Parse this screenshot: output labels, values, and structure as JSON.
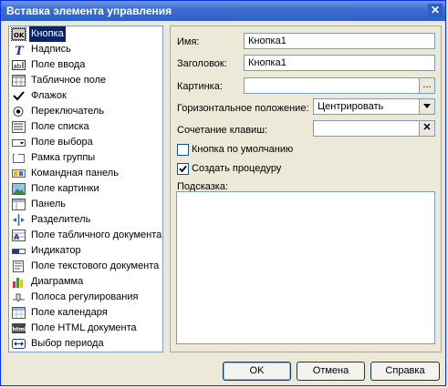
{
  "window": {
    "title": "Вставка элемента управления",
    "close_glyph": "✕"
  },
  "controls_list": [
    {
      "label": "Кнопка",
      "icon": "button-icon",
      "selected": true
    },
    {
      "label": "Надпись",
      "icon": "label-icon"
    },
    {
      "label": "Поле ввода",
      "icon": "input-field-icon"
    },
    {
      "label": "Табличное поле",
      "icon": "table-field-icon"
    },
    {
      "label": "Флажок",
      "icon": "checkbox-icon"
    },
    {
      "label": "Переключатель",
      "icon": "radio-icon"
    },
    {
      "label": "Поле списка",
      "icon": "list-field-icon"
    },
    {
      "label": "Поле выбора",
      "icon": "combo-field-icon"
    },
    {
      "label": "Рамка группы",
      "icon": "group-frame-icon"
    },
    {
      "label": "Командная панель",
      "icon": "command-panel-icon"
    },
    {
      "label": "Поле картинки",
      "icon": "picture-field-icon"
    },
    {
      "label": "Панель",
      "icon": "panel-icon"
    },
    {
      "label": "Разделитель",
      "icon": "splitter-icon"
    },
    {
      "label": "Поле табличного документа",
      "icon": "spreadsheet-field-icon"
    },
    {
      "label": "Индикатор",
      "icon": "indicator-icon"
    },
    {
      "label": "Поле текстового документа",
      "icon": "text-document-field-icon"
    },
    {
      "label": "Диаграмма",
      "icon": "chart-icon"
    },
    {
      "label": "Полоса регулирования",
      "icon": "slider-icon"
    },
    {
      "label": "Поле календаря",
      "icon": "calendar-field-icon"
    },
    {
      "label": "Поле HTML документа",
      "icon": "html-field-icon"
    },
    {
      "label": "Выбор периода",
      "icon": "period-select-icon"
    }
  ],
  "properties": {
    "name_label": "Имя:",
    "name_value": "Кнопка1",
    "caption_label": "Заголовок:",
    "caption_value": "Кнопка1",
    "picture_label": "Картинка:",
    "picture_value": "",
    "picture_button": "...",
    "halign_label": "Горизонтальное положение:",
    "halign_value": "Центрировать",
    "shortcut_label": "Сочетание клавиш:",
    "shortcut_value": "",
    "shortcut_clear": "✕",
    "default_button_label": "Кнопка по умолчанию",
    "default_button_checked": false,
    "create_procedure_label": "Создать процедуру",
    "create_procedure_checked": true,
    "tooltip_label": "Подсказка:",
    "tooltip_value": ""
  },
  "buttons": {
    "ok": "OK",
    "cancel": "Отмена",
    "help": "Справка"
  }
}
